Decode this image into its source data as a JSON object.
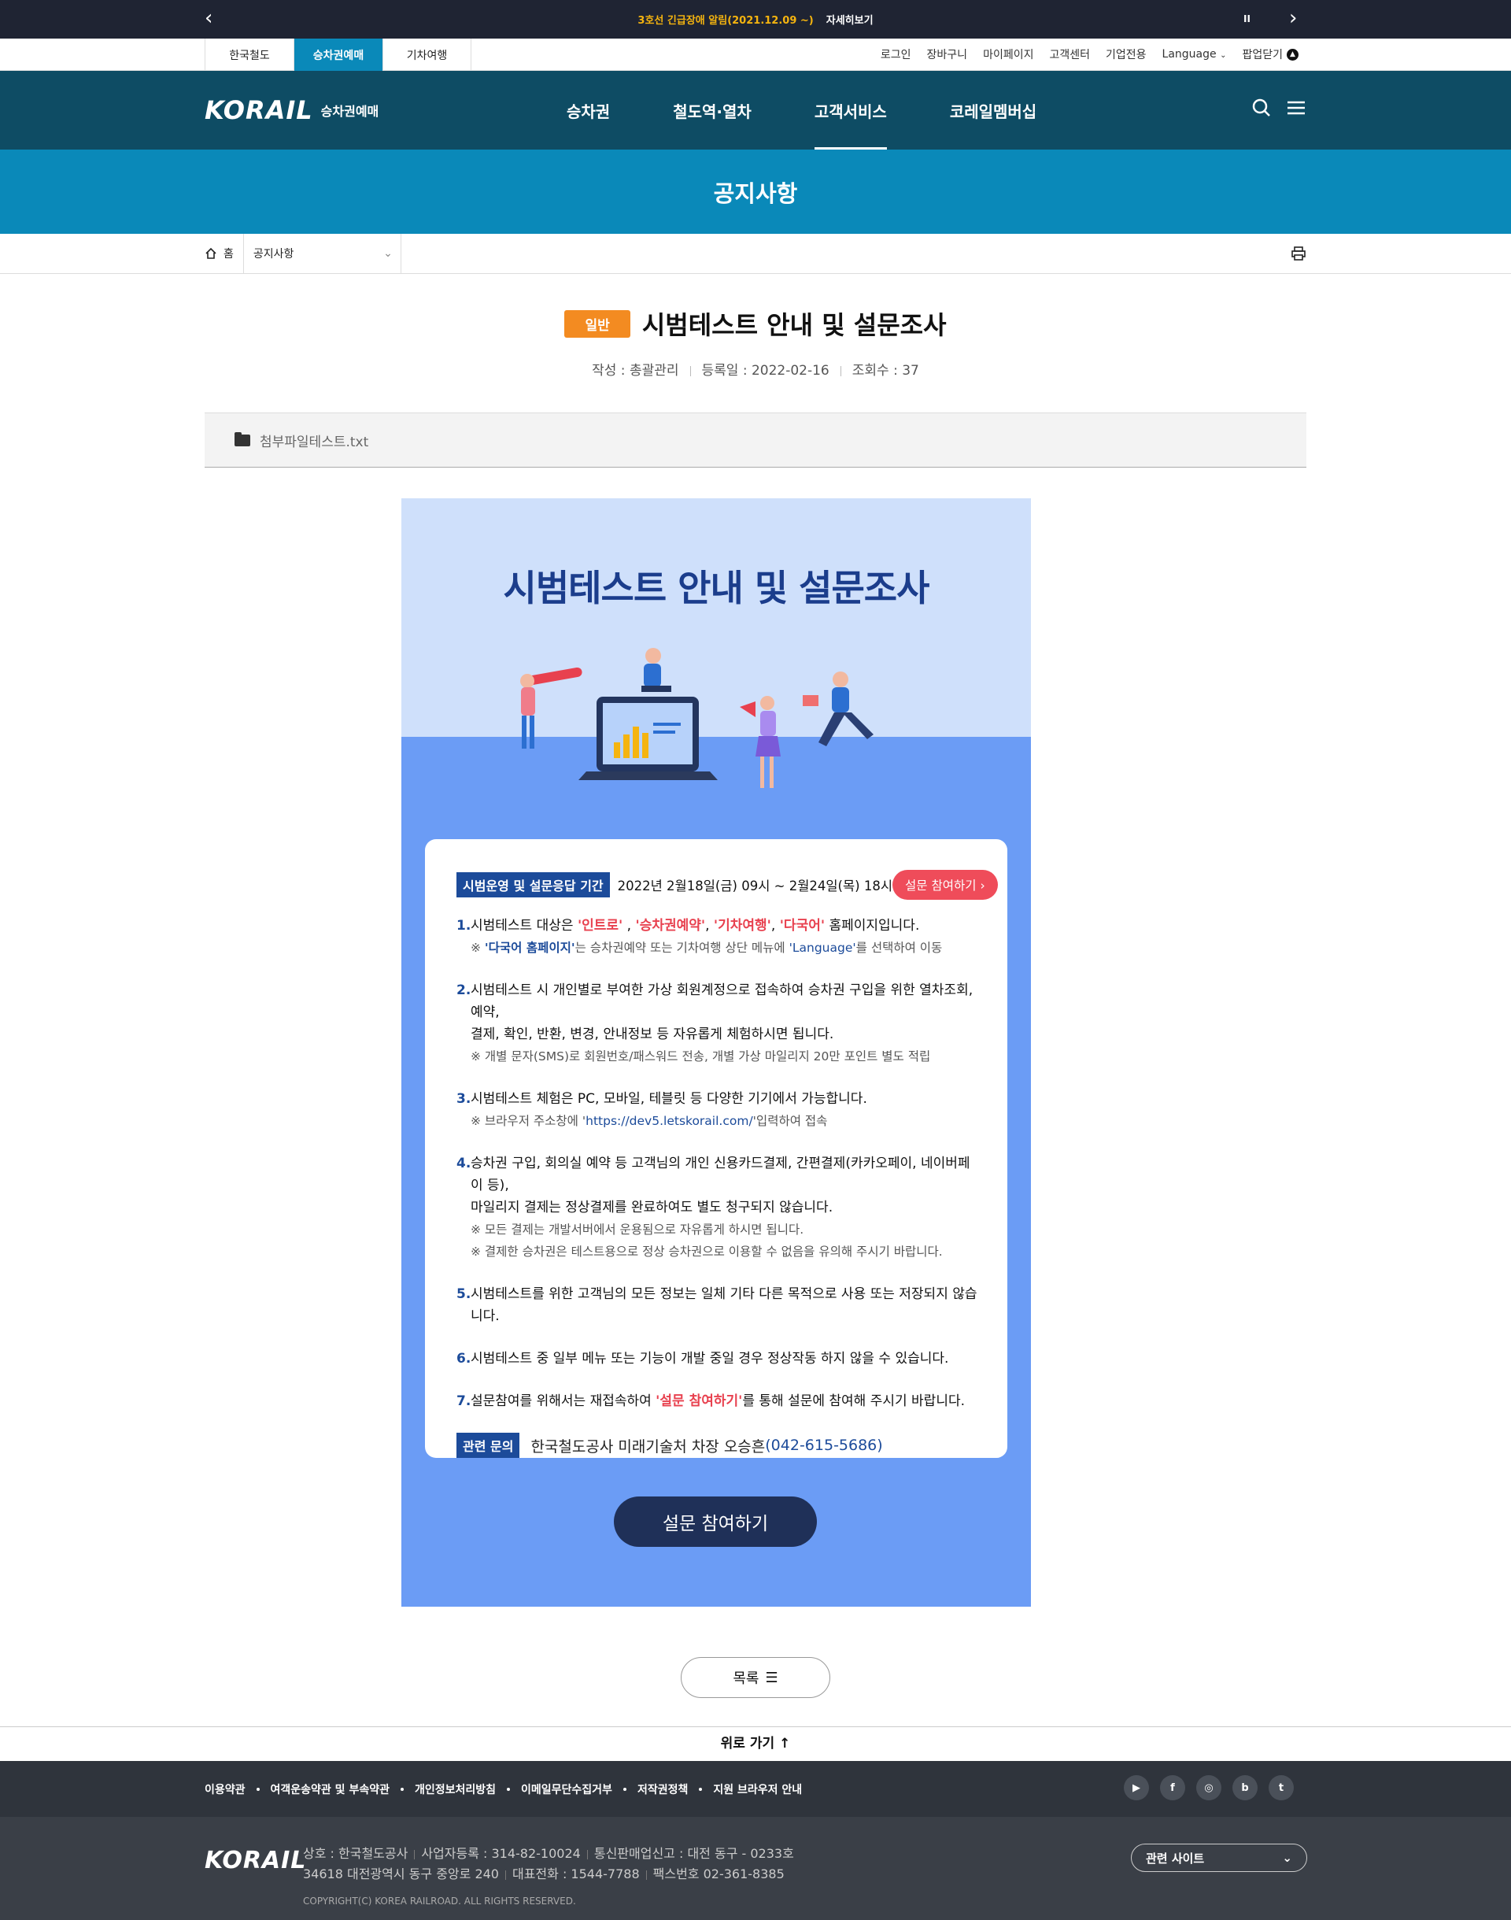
{
  "notice": {
    "text": "3호선 긴급장애 알림(2021.12.09 ~)",
    "link": "자세히보기",
    "pause": "II",
    "prev": "‹",
    "next": "›"
  },
  "site_tabs": [
    "한국철도",
    "승차권예매",
    "기차여행"
  ],
  "util_links": [
    "로그인",
    "장바구니",
    "마이페이지",
    "고객센터",
    "기업전용",
    "Language",
    "팝업닫기"
  ],
  "gnb": {
    "logo": "KORAIL",
    "logo_sub": "승차권예매",
    "menus": [
      "승차권",
      "철도역·열차",
      "고객서비스",
      "코레일멤버십"
    ]
  },
  "sub_title": "공지사항",
  "location": {
    "home": "홈",
    "current": "공지사항"
  },
  "view": {
    "badge": "일반",
    "title": "시범테스트 안내 및 설문조사",
    "author": "작성 : 총괄관리",
    "date": "등록일 : 2022-02-16",
    "views": "조회수 : 37",
    "attachment": "첨부파일테스트.txt"
  },
  "poster": {
    "title": "시범테스트 안내 및 설문조사",
    "period_label": "시범운영 및 설문응답 기간",
    "period": "2022년 2월18일(금) 09시 ~ 2월24일(목) 18시",
    "survey_pill": "설문 참여하기 ›",
    "item1": {
      "num": "1.",
      "pre": "시범테스트 대상은 ",
      "r1": "'인트로'",
      "c1": " , ",
      "r2": "'승차권예약'",
      "c2": ", ",
      "r3": "'기차여행'",
      "c3": ", ",
      "r4": "'다국어'",
      "post": " 홈페이지입니다.",
      "note_pre": "※ ",
      "note_b1": "'다국어 홈페이지'",
      "note_mid": "는 승차권예약 또는 기차여행 상단 메뉴에 ",
      "note_b2": "'Language'",
      "note_post": "를 선택하여 이동"
    },
    "item2": {
      "num": "2.",
      "line1": "시범테스트 시 개인별로 부여한 가상 회원계정으로 접속하여 승차권 구입을 위한 열차조회, 예약,",
      "line2": "결제, 확인, 반환, 변경, 안내정보 등 자유롭게 체험하시면 됩니다.",
      "note": "※ 개별 문자(SMS)로 회원번호/패스워드 전송, 개별 가상 마일리지 20만 포인트 별도 적립"
    },
    "item3": {
      "num": "3.",
      "line1": "시범테스트 체험은 PC, 모바일, 테블릿 등 다양한 기기에서 가능합니다.",
      "note_pre": "※ 브라우저 주소창에 '",
      "note_url": "https://dev5.letskorail.com/",
      "note_post": "'입력하여 접속"
    },
    "item4": {
      "num": "4.",
      "line1": "승차권 구입, 회의실 예약 등 고객님의 개인 신용카드결제, 간편결제(카카오페이, 네이버페이 등),",
      "line2": "마일리지 결제는 정상결제를 완료하여도 별도 청구되지 않습니다.",
      "note1": "※ 모든 결제는 개발서버에서 운용됨으로 자유롭게 하시면 됩니다.",
      "note2": "※ 결제한 승차권은 테스트용으로 정상 승차권으로 이용할 수 없음을 유의해 주시기 바랍니다."
    },
    "item5": {
      "num": "5.",
      "line1": "시범테스트를 위한 고객님의 모든 정보는 일체 기타 다른 목적으로 사용 또는 저장되지 않습니다."
    },
    "item6": {
      "num": "6.",
      "line1": "시범테스트 중 일부 메뉴 또는 기능이 개발 중일 경우 정상작동 하지 않을 수 있습니다."
    },
    "item7": {
      "num": "7.",
      "pre": "설문참여를 위해서는 재접속하여 ",
      "red": "'설문 참여하기'",
      "post": "를 통해 설문에 참여해 주시기 바랍니다."
    },
    "contact_label": "관련 문의",
    "contact_text": "한국철도공사 미래기술처 차장 오승흔",
    "contact_phone": "(042-615-5686)",
    "big_button": "설문 참여하기"
  },
  "list_button": "목록",
  "go_top": "위로 가기 ↑",
  "footer": {
    "links": [
      "이용약관",
      "여객운송약관 및 부속약관",
      "개인정보처리방침",
      "이메일무단수집거부",
      "저작권정책",
      "지원 브라우저 안내"
    ],
    "sns": [
      "youtube-icon",
      "facebook-icon",
      "instagram-icon",
      "blog-icon",
      "twitter-icon"
    ],
    "logo": "KORAIL",
    "company": "상호 : 한국철도공사",
    "bizno": "사업자등록 : 314-82-10024",
    "sales": "통신판매업신고 : 대전 동구 - 0233호",
    "address": "34618 대전광역시 동구 중앙로 240",
    "tel": "대표전화 : 1544-7788",
    "fax": "팩스번호 02-361-8385",
    "copyright": "COPYRIGHT(C) KOREA RAILROAD. ALL RIGHTS RESERVED.",
    "related": "관련 사이트"
  }
}
